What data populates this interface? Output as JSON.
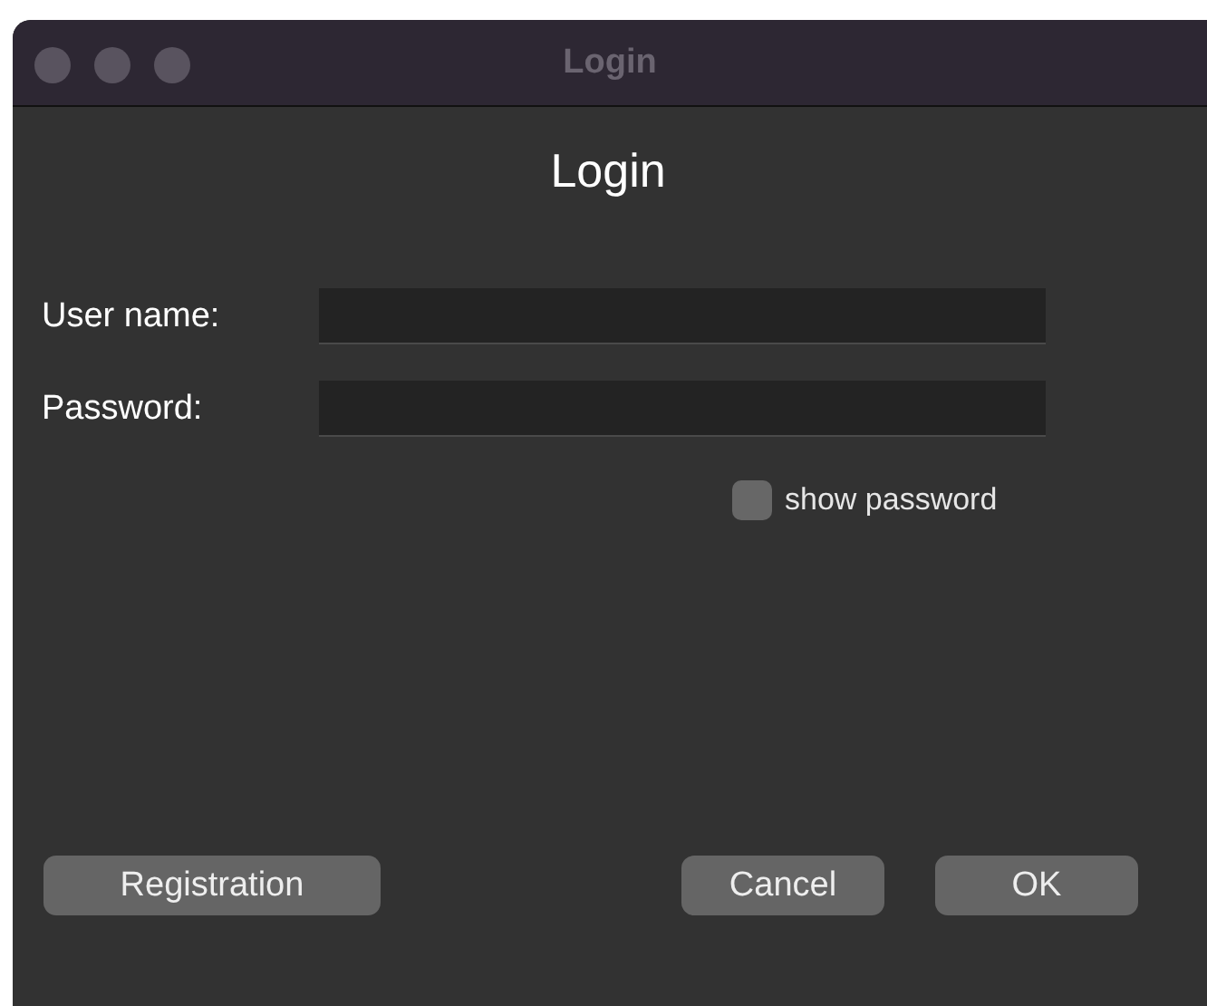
{
  "window": {
    "title": "Login"
  },
  "heading": "Login",
  "fields": [
    {
      "label": "User name:"
    },
    {
      "label": "Password:"
    }
  ],
  "show_password": {
    "label": "show password",
    "checked": false
  },
  "buttons": {
    "left": [
      "Registration"
    ],
    "right": [
      "Cancel",
      "OK"
    ]
  }
}
